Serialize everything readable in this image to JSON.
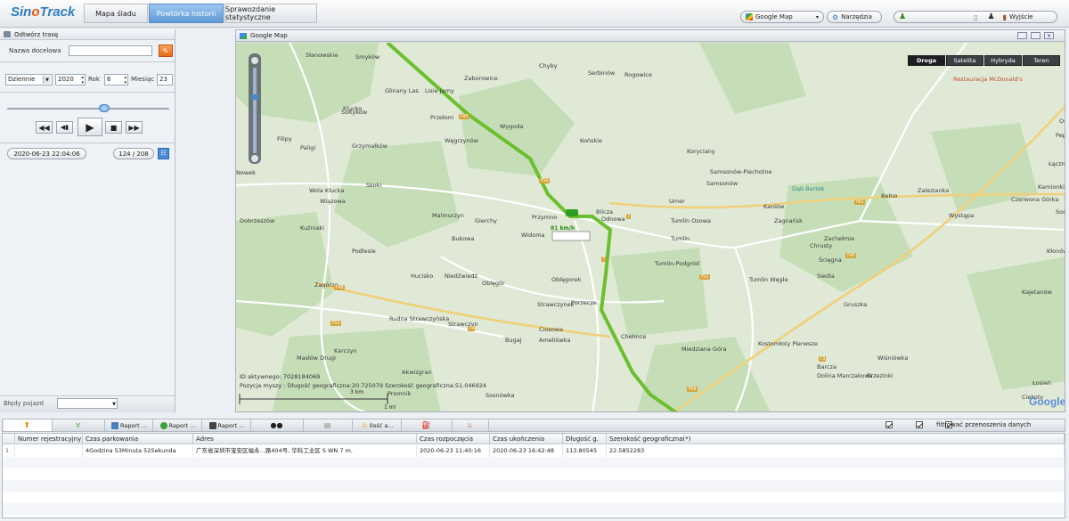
{
  "app": {
    "logo_part1": "Sin",
    "logo_part2": "o",
    "logo_part3": "Track"
  },
  "top_tabs": [
    {
      "label": "Mapa śladu"
    },
    {
      "label": "Powtórka historii"
    },
    {
      "label": "Sprawozdanie statystyczne"
    }
  ],
  "header": {
    "map_select": "Google Map",
    "tools_label": "Narzędzia",
    "user_value": "",
    "logout_label": "Wyjście"
  },
  "left_panel": {
    "title": "Odtwórz trasę",
    "target_label": "Nazwa docelowa",
    "target_value": "",
    "period": "Dziennie",
    "year": "2020",
    "year_label": "Rok",
    "month": "6",
    "month_label": "Miesiąc",
    "day": "23",
    "current_time": "2020-06-23 22:04:06",
    "counter": "124 / 208",
    "vehicle_label": "Błędy pojazd",
    "vehicle_value": ""
  },
  "map": {
    "title": "Google Map",
    "types": [
      "Droga",
      "Satelita",
      "Hybryda",
      "Teren"
    ],
    "selected_type": "Droga",
    "speed_label": "81 km/h",
    "info_id": "ID aktywnego: 7028184069",
    "info_pos": "Pozycja myszy : Długość geograficzna:20.725079 Szerokość geograficzna:51.046924",
    "scale_top": "3 km",
    "scale_bottom": "1 mi",
    "attribution": "Google",
    "restaurant": "Restauracja McDonald's",
    "poi": "Dąb Bartek",
    "places": [
      "Słanowskie",
      "Smyków",
      "Zaborowice",
      "Chyby",
      "Serbinów",
      "Rogowice",
      "Klucko",
      "Glinany Las",
      "Lisie Jamy",
      "Sołtyków",
      "Przełom",
      "Wygoda",
      "Filipy",
      "Paligi",
      "Grzymałków",
      "Węgrzynów",
      "Końskie",
      "Koryciany",
      "Samsonów-Piechotne",
      "Samsonów",
      "Nowek",
      "Skoki",
      "Wola Kłucka",
      "Wiązowa",
      "Zagnańsk",
      "Umer",
      "Belno",
      "Zalezianka",
      "Wystąpa",
      "Czerwona Górka",
      "Łączna",
      "Kamionki",
      "Ostojów",
      "Dobrzeszów",
      "Kuźniaki",
      "Malmurzyn",
      "Gierchy",
      "Przymno",
      "Odnowa",
      "Kaniów",
      "Tumlin Osowa",
      "Tumlin",
      "Zachełmie",
      "Chrusty",
      "Ścięgna",
      "Sośnica",
      "Bukowa",
      "Widoma",
      "Pepice",
      "Podlesie",
      "Hucisko",
      "Niedźwiedź",
      "Oblęgór",
      "Oblęgorek",
      "Tumlin-Podgród",
      "Tumlin Węgle",
      "Siedla",
      "Gruszka",
      "Kajetanów",
      "Kłonów",
      "Zagórze",
      "Rudna Strawczyńska",
      "Strawczyn",
      "Strawczynek",
      "Porzecze",
      "Ciosowa",
      "Bugaj",
      "Chełmce",
      "Miedziana Góra",
      "Kostomłoty Pierwsze",
      "Wiśniówka",
      "Barcza",
      "Dolina Marczakowa",
      "Brzezinki",
      "Masłów Drugi",
      "Karczyn",
      "Akwizgran",
      "Promnik",
      "Łosień",
      "Ciekoty",
      "Ameliówka",
      "Sosnówka",
      "Bilcza"
    ],
    "road_signs": [
      "745",
      "750",
      "7",
      "7",
      "761",
      "748",
      "752",
      "74",
      "751",
      "745",
      "73",
      "766"
    ]
  },
  "bottom_tabs": [
    {
      "label": ""
    },
    {
      "label": ""
    },
    {
      "label": "Raport ..."
    },
    {
      "label": "Raport ..."
    },
    {
      "label": "Raport ..."
    },
    {
      "label": ""
    },
    {
      "label": ""
    },
    {
      "label": "Ilość a..."
    },
    {
      "label": ""
    },
    {
      "label": ""
    }
  ],
  "filter_label": "filtrować przenoszenia danych",
  "table": {
    "headers": [
      "Numer rejestracyjny",
      "Czas parkowania",
      "Adres",
      "Czas rozpoczęcia",
      "Czas ukończenia",
      "Długość g.",
      "Szerokość geograficzna(*)"
    ],
    "rows": [
      {
        "num": "1",
        "reg": "",
        "park": "4Godzina 53Minuta 52Sekunda",
        "addr": "广东省深圳市宝安区福永...路404号, 华科工业区 S WN 7 m.",
        "start": "2020-06-23 11:40:16",
        "end": "2020-06-23 16:42:48",
        "lng": "113.80545",
        "lat": "22.5852283"
      }
    ]
  },
  "colors": {
    "accent": "#5c9ad6",
    "route": "#6cbf2e",
    "map_bg": "#d7e6cf"
  }
}
